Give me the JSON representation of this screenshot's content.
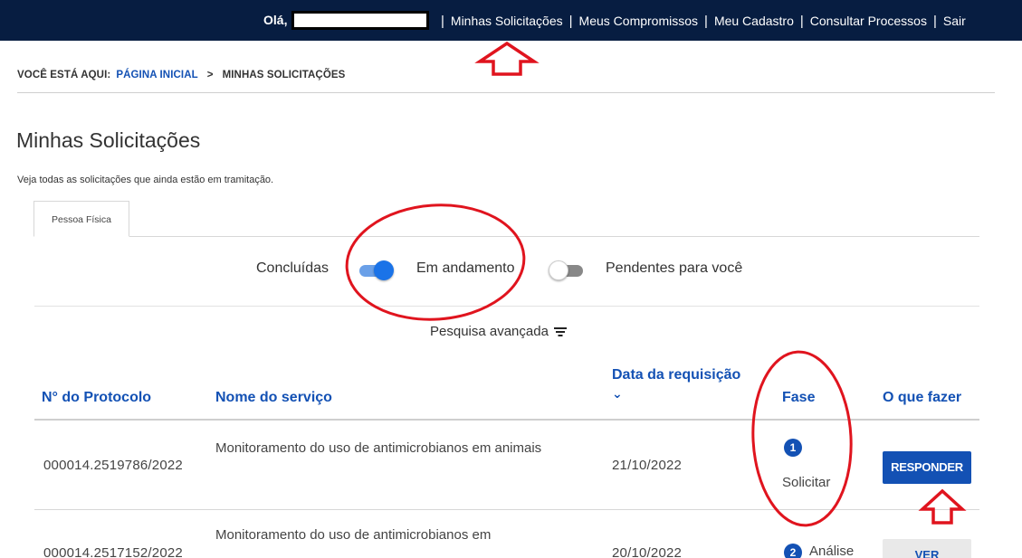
{
  "topbar": {
    "greeting": "Olá,",
    "nav": [
      {
        "label": "Minhas Solicitações"
      },
      {
        "label": "Meus Compromissos"
      },
      {
        "label": "Meu Cadastro"
      },
      {
        "label": "Consultar Processos"
      },
      {
        "label": "Sair"
      }
    ]
  },
  "breadcrumb": {
    "prefix": "VOCÊ ESTÁ AQUI:",
    "home": "PÁGINA INICIAL",
    "separator": ">",
    "current": "MINHAS SOLICITAÇÕES"
  },
  "page": {
    "title": "Minhas Solicitações",
    "subtitle": "Veja todas as solicitações que ainda estão em tramitação."
  },
  "tabs": [
    {
      "label": "Pessoa Física",
      "active": true
    }
  ],
  "filters": {
    "concluidas": "Concluídas",
    "em_andamento": "Em andamento",
    "em_andamento_on": true,
    "pendentes": "Pendentes para você",
    "pendentes_on": false
  },
  "advanced_search": "Pesquisa avançada",
  "table": {
    "headers": {
      "protocol": "N° do Protocolo",
      "service": "Nome do serviço",
      "date": "Data da requisição",
      "phase": "Fase",
      "action": "O que fazer"
    },
    "rows": [
      {
        "protocol": "000014.2519786/2022",
        "service": "Monitoramento do uso de antimicrobianos em animais",
        "date": "21/10/2022",
        "phase_num": "1",
        "phase": "Solicitar",
        "action": "RESPONDER"
      },
      {
        "protocol": "000014.2517152/2022",
        "service": "Monitoramento do uso de antimicrobianos em",
        "date": "20/10/2022",
        "phase_num": "2",
        "phase": "Análise",
        "action": "VER"
      }
    ]
  },
  "colors": {
    "topbar": "#071d41",
    "link_blue": "#1351b4",
    "toggle_on": "#1a73e8",
    "annotation_red": "#e0141e"
  }
}
